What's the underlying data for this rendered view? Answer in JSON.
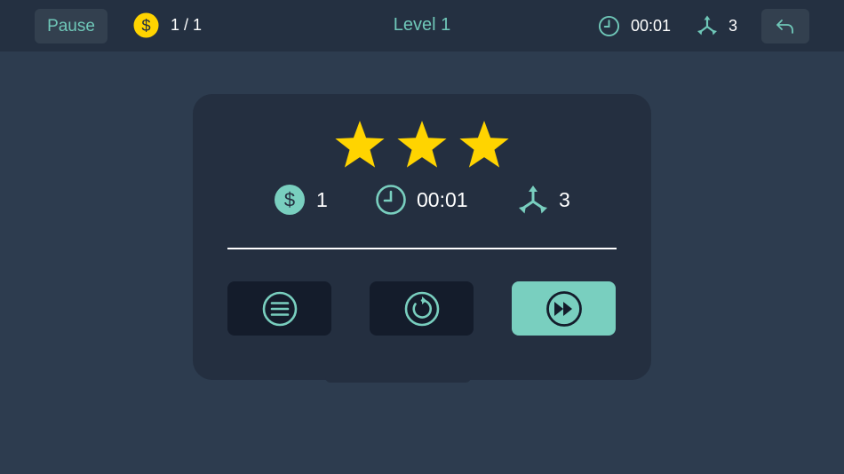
{
  "topbar": {
    "pause_label": "Pause",
    "coins": "1 / 1",
    "level_title": "Level 1",
    "time": "00:01",
    "moves": "3"
  },
  "result": {
    "stars": 3,
    "stars_max": 3,
    "coins": "1",
    "time": "00:01",
    "moves": "3"
  },
  "icons": {
    "coin": "dollar-coin-icon",
    "clock": "clock-icon",
    "moves": "tri-arrow-icon",
    "undo": "undo-arrow-icon",
    "menu": "menu-lines-icon",
    "restart": "restart-icon",
    "next": "fast-forward-icon"
  },
  "colors": {
    "background": "#2d3c4f",
    "topbar": "#243041",
    "panel": "#242f40",
    "accent": "#79cfbf",
    "teal_text": "#6fc7b8",
    "star": "#ffd400",
    "coin": "#ffd400"
  }
}
